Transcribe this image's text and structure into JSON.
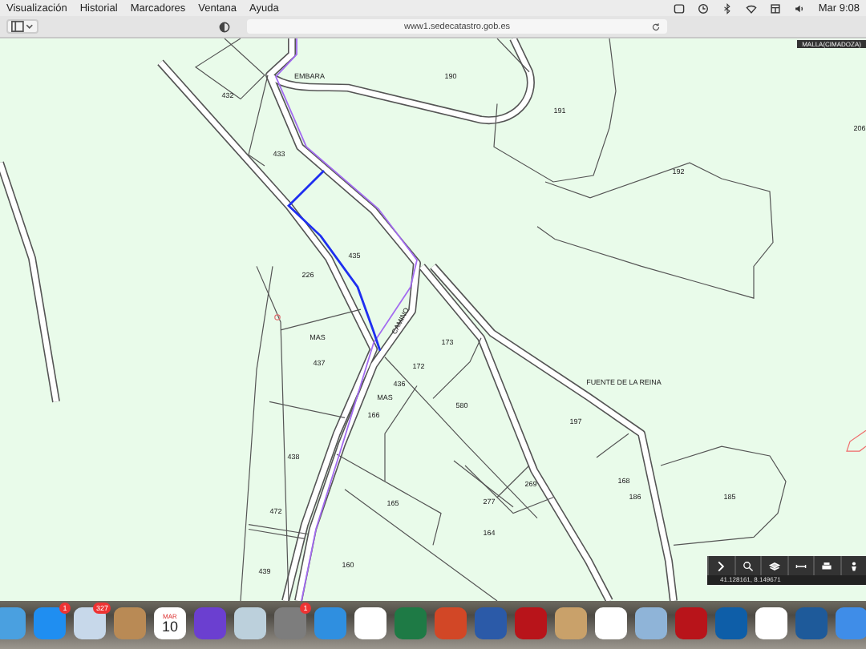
{
  "menu_bar": {
    "items": [
      "Visualización",
      "Historial",
      "Marcadores",
      "Ventana",
      "Ayuda"
    ],
    "clock": "Mar 9:08"
  },
  "browser": {
    "url": "www1.sedecatastro.gob.es"
  },
  "map": {
    "layer_label": "MALLA(CIMADOZA)",
    "parcel_labels": [
      "432",
      "EMBARA",
      "190",
      "191",
      "192",
      "206",
      "433",
      "435",
      "226",
      "MAS",
      "437",
      "436",
      "MAS",
      "CAMINO",
      "173",
      "172",
      "166",
      "580",
      "FUENTE DE LA REINA",
      "197",
      "438",
      "269",
      "277",
      "168",
      "186",
      "185",
      "165",
      "164",
      "472",
      "439",
      "160"
    ],
    "coordinates": "41.128161, 8.149671"
  },
  "dock": {
    "app_store_badge": "1",
    "mail_badge": "327",
    "calendar_month": "MAR",
    "calendar_day": "10",
    "settings_badge": "1"
  }
}
